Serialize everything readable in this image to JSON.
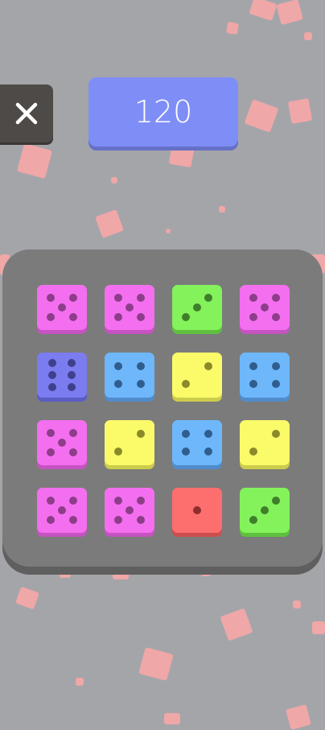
{
  "header": {
    "close_icon": "close-icon",
    "score": "120",
    "score_color": "#7f8ef6"
  },
  "board": {
    "rows": 4,
    "cols": 4,
    "dice": [
      {
        "color": "pink",
        "value": 5
      },
      {
        "color": "pink",
        "value": 5
      },
      {
        "color": "green",
        "value": 3
      },
      {
        "color": "pink",
        "value": 5
      },
      {
        "color": "purple",
        "value": 6
      },
      {
        "color": "blue",
        "value": 4
      },
      {
        "color": "yellow",
        "value": 2
      },
      {
        "color": "blue",
        "value": 4
      },
      {
        "color": "pink",
        "value": 5
      },
      {
        "color": "yellow",
        "value": 2
      },
      {
        "color": "blue",
        "value": 4
      },
      {
        "color": "yellow",
        "value": 2
      },
      {
        "color": "pink",
        "value": 5
      },
      {
        "color": "pink",
        "value": 5
      },
      {
        "color": "red",
        "value": 1
      },
      {
        "color": "green",
        "value": 3
      }
    ]
  },
  "colors": {
    "pink": {
      "face": "#f46ff0",
      "shade": "#c653c2",
      "pip": "#8d3d89"
    },
    "green": {
      "face": "#84f25b",
      "shade": "#5fc03f",
      "pip": "#3f7f2a"
    },
    "purple": {
      "face": "#7b7cf0",
      "shade": "#5b5cc4",
      "pip": "#3f3f8c"
    },
    "blue": {
      "face": "#6eb7fb",
      "shade": "#508ccc",
      "pip": "#2f5e8e"
    },
    "yellow": {
      "face": "#fbfb6a",
      "shade": "#cccc4c",
      "pip": "#8a8a2a"
    },
    "red": {
      "face": "#fd6e6e",
      "shade": "#cc4e4e",
      "pip": "#8e2d2d"
    }
  },
  "background_color": "#a4a5a9",
  "confetti_color": "#f3a6a8"
}
